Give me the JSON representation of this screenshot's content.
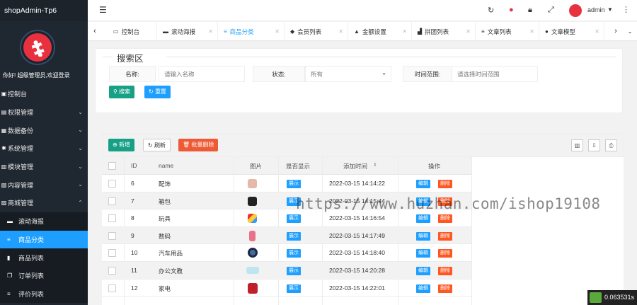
{
  "sidebar": {
    "brand": "shopAdmin-Tp6",
    "welcome": "你好! 超级管理员,欢迎登录",
    "menu": [
      {
        "label": "控制台",
        "icon": "home-icon",
        "chevron": false
      },
      {
        "label": "权限管理",
        "icon": "lock-icon",
        "chevron": true
      },
      {
        "label": "数据备份",
        "icon": "database-icon",
        "chevron": true
      },
      {
        "label": "系统管理",
        "icon": "gear-icon",
        "chevron": true
      },
      {
        "label": "模块管理",
        "icon": "module-icon",
        "chevron": true
      },
      {
        "label": "内容管理",
        "icon": "content-icon",
        "chevron": true
      },
      {
        "label": "商城管理",
        "icon": "shop-icon",
        "chevron": true
      }
    ],
    "submenu": [
      {
        "label": "滚动海报",
        "icon": "banner-icon",
        "active": false
      },
      {
        "label": "商品分类",
        "icon": "list-icon",
        "active": true
      },
      {
        "label": "商品列表",
        "icon": "bookmark-icon",
        "active": false
      },
      {
        "label": "订单列表",
        "icon": "copy-icon",
        "active": false
      },
      {
        "label": "评价列表",
        "icon": "list-icon",
        "active": false
      }
    ]
  },
  "topbar": {
    "admin_name": "admin"
  },
  "tabs": [
    {
      "label": "控制台",
      "closable": false,
      "active": false
    },
    {
      "label": "滚动海报",
      "closable": true,
      "active": false
    },
    {
      "label": "商品分类",
      "closable": true,
      "active": true
    },
    {
      "label": "会员列表",
      "closable": true,
      "active": false
    },
    {
      "label": "金额设置",
      "closable": true,
      "active": false
    },
    {
      "label": "拼团列表",
      "closable": true,
      "active": false
    },
    {
      "label": "文章列表",
      "closable": true,
      "active": false
    },
    {
      "label": "文章模型",
      "closable": true,
      "active": false
    }
  ],
  "search": {
    "legend": "搜索区",
    "name_label": "名称:",
    "name_placeholder": "请输入名称",
    "status_label": "状态:",
    "status_value": "所有",
    "time_label": "时间范围:",
    "time_placeholder": "请选择时间范围",
    "search_button": "搜索",
    "reset_button": "重置"
  },
  "toolbar": {
    "add_button": "新增",
    "refresh_button": "刷新",
    "batch_delete_button": "批量删除"
  },
  "table": {
    "headers": {
      "id": "ID",
      "name": "name",
      "image": "图片",
      "show": "是否显示",
      "time": "添加时间",
      "action": "操作"
    },
    "show_badge": "展示",
    "edit_label": "编辑",
    "delete_label": "删除",
    "rows": [
      {
        "id": "6",
        "name": "配饰",
        "time": "2022-03-15 14:14:22"
      },
      {
        "id": "7",
        "name": "箱包",
        "time": "2022-03-15 14:15:44"
      },
      {
        "id": "8",
        "name": "玩具",
        "time": "2022-03-15 14:16:54"
      },
      {
        "id": "9",
        "name": "数码",
        "time": "2022-03-15 14:17:49"
      },
      {
        "id": "10",
        "name": "汽车用品",
        "time": "2022-03-15 14:18:40"
      },
      {
        "id": "11",
        "name": "办公文教",
        "time": "2022-03-15 14:20:28"
      },
      {
        "id": "12",
        "name": "家电",
        "time": "2022-03-15 14:22:01"
      }
    ]
  },
  "watermark": "https://www.huzhan.com/ishop19108",
  "timer": "0.063531s",
  "colors": {
    "sidebar_bg": "#1f2730",
    "active_blue": "#1e9fff",
    "green": "#16b777",
    "teal": "#16a085",
    "red": "#ee5a35",
    "delete_red": "#ff5722"
  }
}
